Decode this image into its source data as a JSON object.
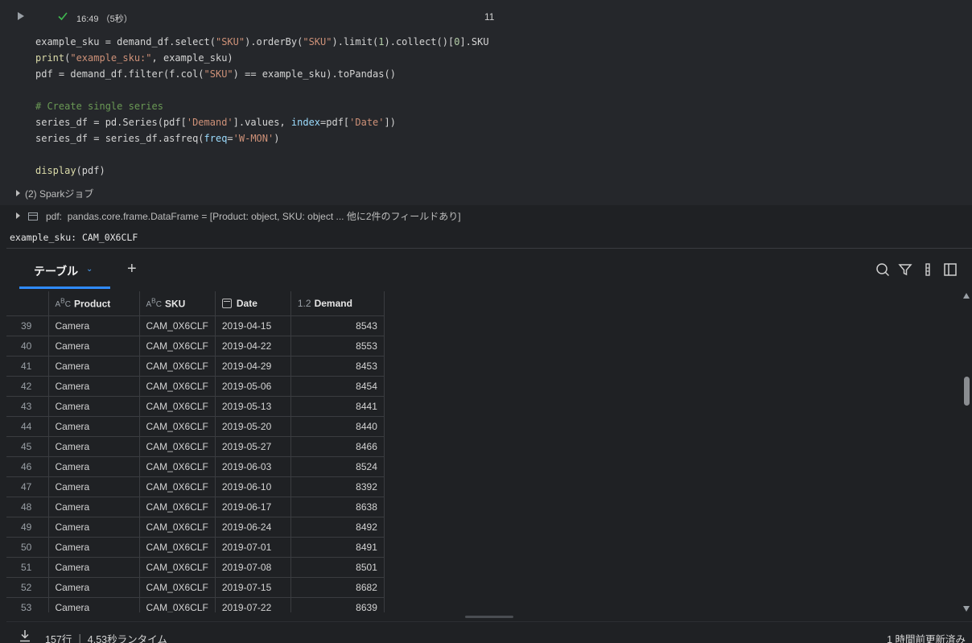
{
  "cell": {
    "exec_time": "16:49 （5秒）",
    "cell_number": "11",
    "code_lines": [
      [
        {
          "t": "example_sku = demand_df.select("
        },
        {
          "t": "\"SKU\"",
          "c": "s"
        },
        {
          "t": ").orderBy("
        },
        {
          "t": "\"SKU\"",
          "c": "s"
        },
        {
          "t": ").limit("
        },
        {
          "t": "1",
          "c": "n"
        },
        {
          "t": ").collect()["
        },
        {
          "t": "0",
          "c": "n"
        },
        {
          "t": "].SKU"
        }
      ],
      [
        {
          "t": "print",
          "c": "f"
        },
        {
          "t": "("
        },
        {
          "t": "\"example_sku:\"",
          "c": "s"
        },
        {
          "t": ", example_sku)"
        }
      ],
      [
        {
          "t": "pdf = demand_df.filter(f.col("
        },
        {
          "t": "\"SKU\"",
          "c": "s"
        },
        {
          "t": ") == example_sku).toPandas()"
        }
      ],
      [],
      [
        {
          "t": "# Create single series",
          "c": "c"
        }
      ],
      [
        {
          "t": "series_df = pd.Series(pdf["
        },
        {
          "t": "'Demand'",
          "c": "s"
        },
        {
          "t": "].values, "
        },
        {
          "t": "index",
          "c": "k"
        },
        {
          "t": "=pdf["
        },
        {
          "t": "'Date'",
          "c": "s"
        },
        {
          "t": "])"
        }
      ],
      [
        {
          "t": "series_df = series_df.asfreq("
        },
        {
          "t": "freq",
          "c": "k"
        },
        {
          "t": "="
        },
        {
          "t": "'W-MON'",
          "c": "s"
        },
        {
          "t": ")"
        }
      ],
      [],
      [
        {
          "t": "display",
          "c": "f"
        },
        {
          "t": "(pdf)"
        }
      ]
    ],
    "spark_jobs": "(2) Sparkジョブ",
    "df_label": "pdf:",
    "df_desc": "pandas.core.frame.DataFrame = [Product: object, SKU: object ... 他に2件のフィールドあり]",
    "stdout": "example_sku: CAM_0X6CLF"
  },
  "toolbar": {
    "tab_label": "テーブル",
    "add_tab": "+",
    "icons": [
      "search-icon",
      "filter-icon",
      "column-settings-icon",
      "panel-toggle-icon"
    ]
  },
  "table": {
    "columns": [
      {
        "type": "ABC",
        "label": "Product"
      },
      {
        "type": "ABC",
        "label": "SKU"
      },
      {
        "type": "calendar",
        "label": "Date"
      },
      {
        "type": "1.2",
        "label": "Demand"
      }
    ],
    "rows": [
      [
        "39",
        "Camera",
        "CAM_0X6CLF",
        "2019-04-15",
        "8543"
      ],
      [
        "40",
        "Camera",
        "CAM_0X6CLF",
        "2019-04-22",
        "8553"
      ],
      [
        "41",
        "Camera",
        "CAM_0X6CLF",
        "2019-04-29",
        "8453"
      ],
      [
        "42",
        "Camera",
        "CAM_0X6CLF",
        "2019-05-06",
        "8454"
      ],
      [
        "43",
        "Camera",
        "CAM_0X6CLF",
        "2019-05-13",
        "8441"
      ],
      [
        "44",
        "Camera",
        "CAM_0X6CLF",
        "2019-05-20",
        "8440"
      ],
      [
        "45",
        "Camera",
        "CAM_0X6CLF",
        "2019-05-27",
        "8466"
      ],
      [
        "46",
        "Camera",
        "CAM_0X6CLF",
        "2019-06-03",
        "8524"
      ],
      [
        "47",
        "Camera",
        "CAM_0X6CLF",
        "2019-06-10",
        "8392"
      ],
      [
        "48",
        "Camera",
        "CAM_0X6CLF",
        "2019-06-17",
        "8638"
      ],
      [
        "49",
        "Camera",
        "CAM_0X6CLF",
        "2019-06-24",
        "8492"
      ],
      [
        "50",
        "Camera",
        "CAM_0X6CLF",
        "2019-07-01",
        "8491"
      ],
      [
        "51",
        "Camera",
        "CAM_0X6CLF",
        "2019-07-08",
        "8501"
      ],
      [
        "52",
        "Camera",
        "CAM_0X6CLF",
        "2019-07-15",
        "8682"
      ],
      [
        "53",
        "Camera",
        "CAM_0X6CLF",
        "2019-07-22",
        "8639"
      ]
    ]
  },
  "footer": {
    "rows_info": "157行 ｜ 4.53秒ランタイム",
    "updated": "1 時間前更新済み"
  },
  "colors": {
    "background": "#1f2124",
    "cell_bg": "#25272b",
    "accent": "#2f8bff",
    "success": "#3fb950"
  }
}
